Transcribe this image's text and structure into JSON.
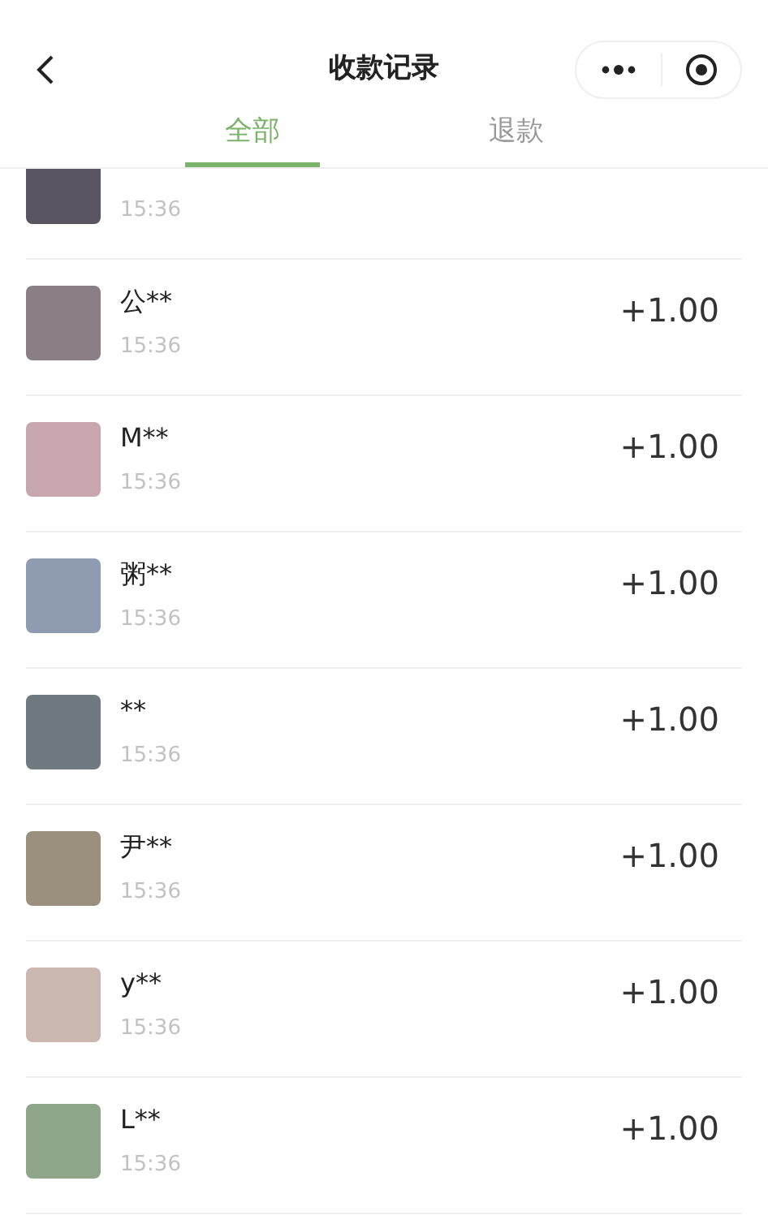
{
  "nav": {
    "title": "收款记录"
  },
  "tabs": [
    {
      "label": "全部",
      "selected": true
    },
    {
      "label": "退款",
      "selected": false
    }
  ],
  "records": [
    {
      "time": "15:36"
    },
    {
      "name": "公**",
      "time": "15:36",
      "amount": "+1.00"
    },
    {
      "name": "M**",
      "time": "15:36",
      "amount": "+1.00"
    },
    {
      "name": "粥**",
      "time": "15:36",
      "amount": "+1.00"
    },
    {
      "name": "**",
      "time": "15:36",
      "amount": "+1.00"
    },
    {
      "name": "尹**",
      "time": "15:36",
      "amount": "+1.00"
    },
    {
      "name": "y**",
      "time": "15:36",
      "amount": "+1.00"
    },
    {
      "name": "L**",
      "time": "15:36",
      "amount": "+1.00"
    }
  ]
}
